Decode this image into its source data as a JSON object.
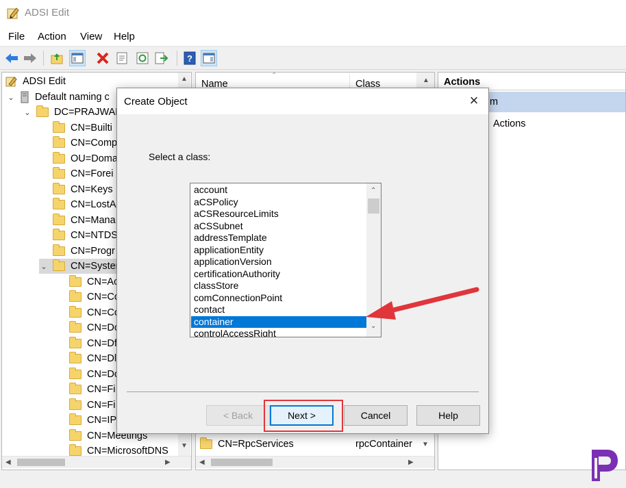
{
  "window": {
    "title": "ADSI Edit",
    "icon": "adsi-edit-icon"
  },
  "menu": [
    "File",
    "Action",
    "View",
    "Help"
  ],
  "toolbar": {
    "buttons": [
      "back-arrow-icon",
      "forward-arrow-icon",
      "up-folder-icon",
      "show-hide-tree-icon",
      "delete-icon",
      "properties-icon",
      "refresh-icon",
      "export-list-icon",
      "help-icon",
      "show-hide-action-pane-icon"
    ]
  },
  "tree": {
    "root": "ADSI Edit",
    "naming_context": "Default naming c",
    "domain": "DC=PRAJWAL",
    "level1": [
      "CN=Builti",
      "CN=Comp",
      "OU=Doma",
      "CN=Forei",
      "CN=Keys",
      "CN=LostA",
      "CN=Mana",
      "CN=NTDS",
      "CN=Progr"
    ],
    "system": "CN=Syster",
    "level2": [
      "CN=Ac",
      "CN=Cc",
      "CN=Cc",
      "CN=Dc",
      "CN=Df",
      "CN=Dl",
      "CN=Dc",
      "CN=Fi",
      "CN=Fi",
      "CN=IP",
      "CN=Meetings",
      "CN=MicrosoftDNS"
    ]
  },
  "list": {
    "columns": {
      "name": "Name",
      "class": "Class"
    },
    "visible_row": {
      "name": "CN=RpcServices",
      "class": "rpcContainer"
    }
  },
  "actions": {
    "header": "Actions",
    "selected_item_suffix": "m",
    "more_actions": "Actions"
  },
  "dialog": {
    "title": "Create Object",
    "prompt": "Select a class:",
    "classes": [
      "account",
      "aCSPolicy",
      "aCSResourceLimits",
      "aCSSubnet",
      "addressTemplate",
      "applicationEntity",
      "applicationVersion",
      "certificationAuthority",
      "classStore",
      "comConnectionPoint",
      "contact",
      "container",
      "controlAccessRight"
    ],
    "selected_class": "container",
    "buttons": {
      "back": "< Back",
      "next": "Next >",
      "cancel": "Cancel",
      "help": "Help"
    }
  },
  "colors": {
    "selection": "#0078d7",
    "annotation": "#e0353b",
    "brand": "#7b2fb5"
  }
}
